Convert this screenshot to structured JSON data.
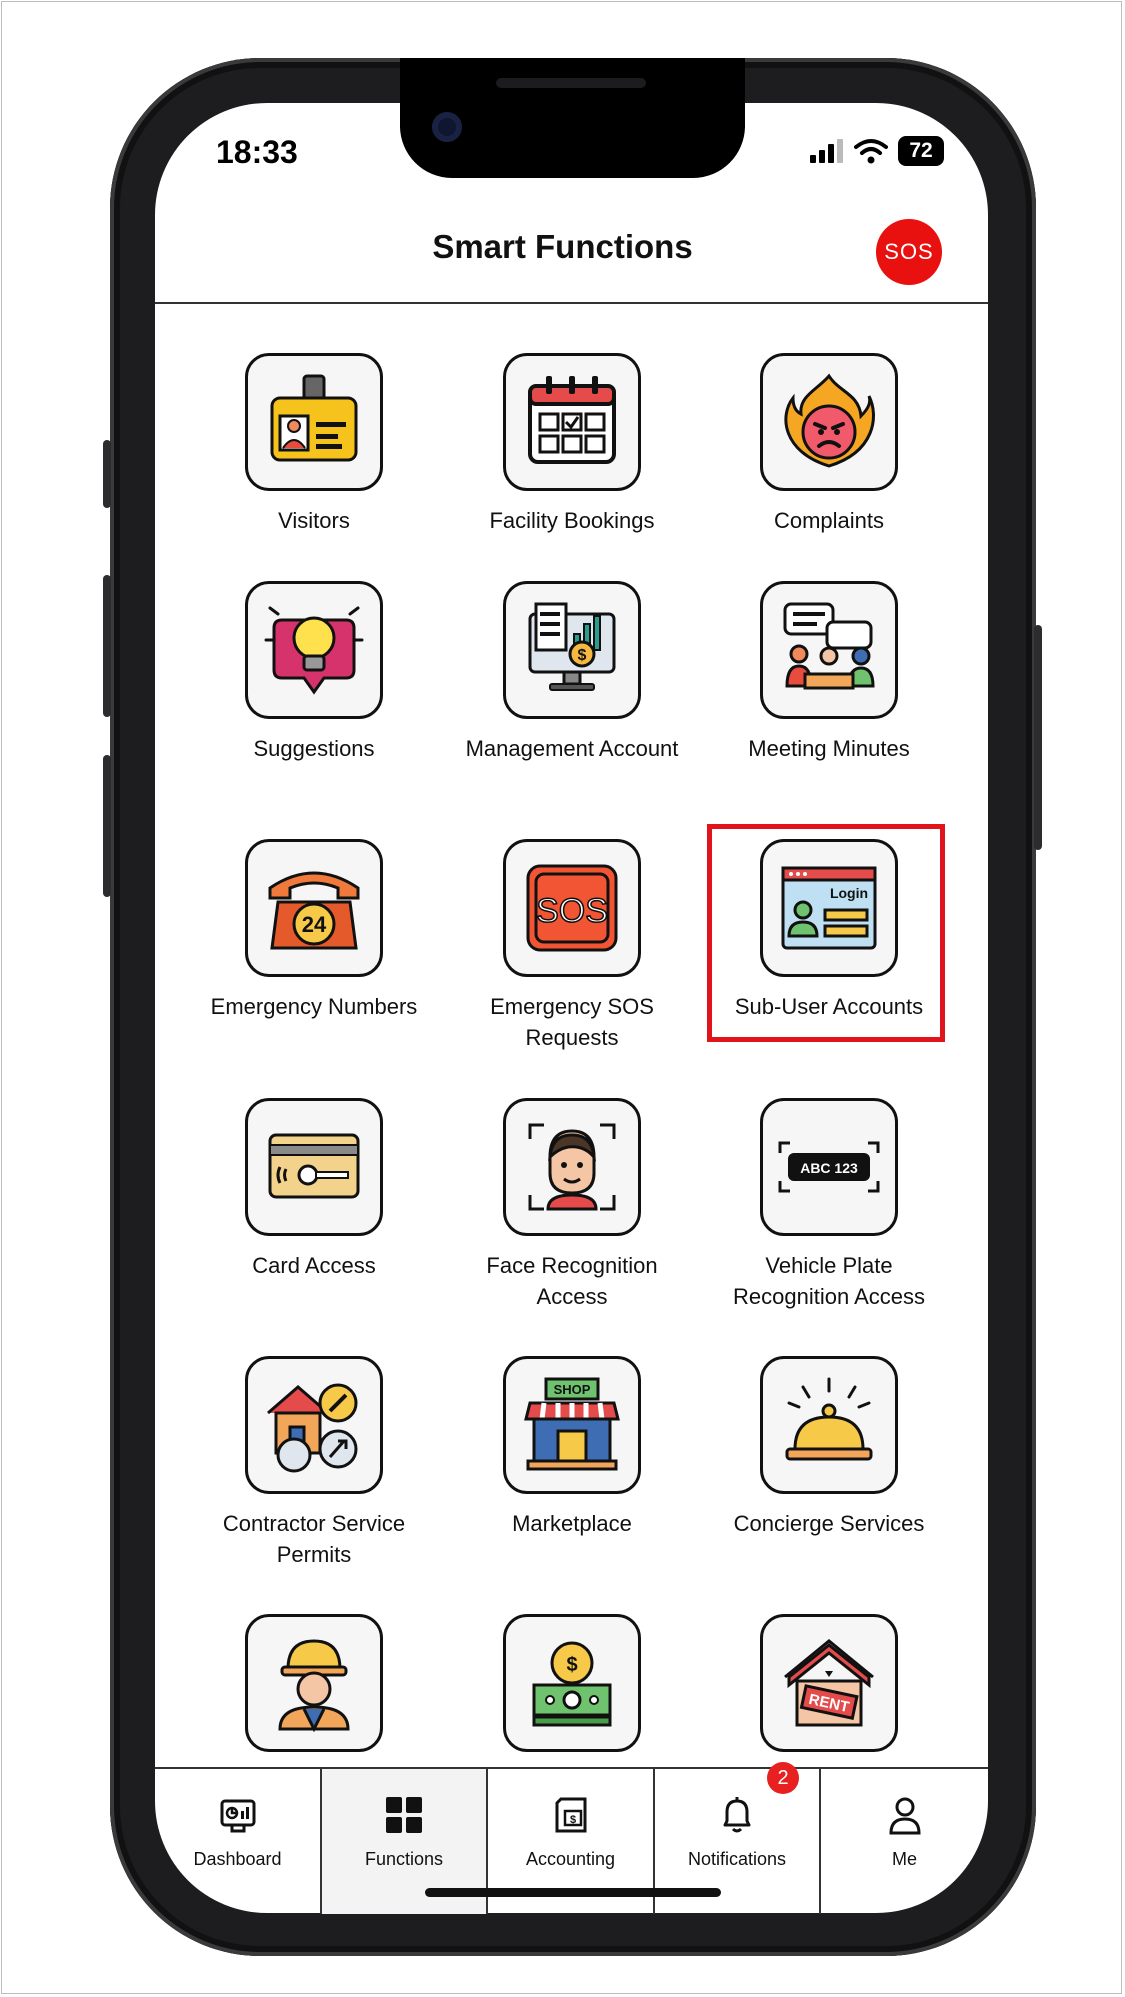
{
  "status": {
    "time": "18:33",
    "battery": "72"
  },
  "header": {
    "title": "Smart Functions",
    "sos_label": "SOS"
  },
  "functions": [
    {
      "label": "Visitors",
      "icon": "visitor-badge-icon"
    },
    {
      "label": "Facility Bookings",
      "icon": "calendar-icon"
    },
    {
      "label": "Complaints",
      "icon": "angry-face-fire-icon"
    },
    {
      "label": "Suggestions",
      "icon": "lightbulb-icon"
    },
    {
      "label": "Management Account",
      "icon": "finance-monitor-icon"
    },
    {
      "label": "Meeting Minutes",
      "icon": "meeting-icon"
    },
    {
      "label": "Emergency Numbers",
      "icon": "emergency-phone-icon"
    },
    {
      "label": "Emergency SOS Requests",
      "icon": "sos-icon"
    },
    {
      "label": "Sub-User Accounts",
      "icon": "login-window-icon",
      "highlighted": true
    },
    {
      "label": "Card Access",
      "icon": "key-card-icon"
    },
    {
      "label": "Face Recognition Access",
      "icon": "face-scan-icon"
    },
    {
      "label": "Vehicle Plate Recognition Access",
      "icon": "license-plate-icon"
    },
    {
      "label": "Contractor Service Permits",
      "icon": "house-tools-icon"
    },
    {
      "label": "Marketplace",
      "icon": "shop-icon"
    },
    {
      "label": "Concierge Services",
      "icon": "service-bell-icon"
    },
    {
      "label": "",
      "icon": "worker-icon"
    },
    {
      "label": "",
      "icon": "money-gear-icon"
    },
    {
      "label": "",
      "icon": "rent-house-icon"
    }
  ],
  "icon_text": {
    "login": "Login",
    "sos": "SOS",
    "plate": "ABC 123",
    "shop": "SHOP",
    "rent": "RENT",
    "emergency": "24"
  },
  "tabs": [
    {
      "label": "Dashboard",
      "icon": "dashboard-icon"
    },
    {
      "label": "Functions",
      "icon": "grid-icon",
      "active": true
    },
    {
      "label": "Accounting",
      "icon": "invoice-icon"
    },
    {
      "label": "Notifications",
      "icon": "bell-icon",
      "badge": "2"
    },
    {
      "label": "Me",
      "icon": "user-icon"
    }
  ],
  "colors": {
    "accent_red": "#e8110f",
    "highlight": "#e0141a"
  }
}
